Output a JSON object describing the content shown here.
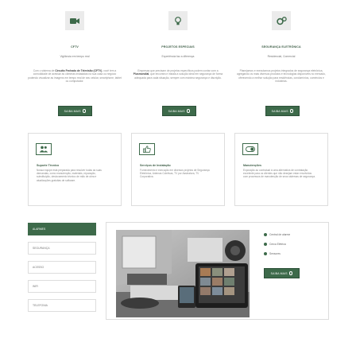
{
  "services": [
    {
      "icon": "video-camera-icon",
      "title": "CFTV",
      "subtitle": "Vigilância em tempo real",
      "description_pre": "Com o sistema de ",
      "description_bold": "Circuito Fechado de Televisão (CFTV)",
      "description_post": ", você tem a comodidade de acessar as câmeras instaladas na sua casa ou negócio podendo visualizar as imagens em tempo real de seu celular, smartphone, tablet ou computador.",
      "button": "Saiba mais"
    },
    {
      "icon": "lightbulb-icon",
      "title": "Projetos especiais",
      "subtitle": "Experiência faz a diferença",
      "description_pre": "Empresas que precisam de projetos específicos podem contar com a ",
      "description_bold": "Plusmondial",
      "description_post": ", que encontra e instala a solução ideal em segurança de forma adequada para cada situação, sempre com máxima segurança e discrição.",
      "button": "Saiba mais"
    },
    {
      "icon": "gears-icon",
      "title": "Segurança eletrônica",
      "subtitle": "Residencial, Comercial",
      "description_pre": "Planejamos e executamos projetos integrados de segurança eletrônica, agregando os mais diversos produtos e tecnologias disponíveis no mercado, oferecendo a melhor solução para residências, condomínios, comércios e indústrias.",
      "description_bold": "",
      "description_post": "",
      "button": "Saiba mais"
    }
  ],
  "cards": [
    {
      "icon": "users-icon",
      "title": "Suporte Técnico",
      "description": "Nossa equipe está preparada para resolver todas as suas demandas, como manutenção, materiais, reparação, substituição, deslocamento técnico de mão de obra e atualizações gratuitas de software."
    },
    {
      "icon": "thumbs-up-icon",
      "title": "Serviços de Instalação",
      "description": "Fornecimento e execução em diversos projetos de Segurança Eletrônica, Antenas Coletivas, TV por Assinatura, TV Corporativa."
    },
    {
      "icon": "toggle-icon",
      "title": "Manutenções",
      "description": "Exposição ao contratual à uma alternativa de contratação excelente para os clientes que não desejam estar envolvidos com processos de manutenção de seus sistemas de segurança."
    }
  ],
  "tabs": [
    "Alarmes",
    "Segurança",
    "Acesso",
    "WiFi",
    "Telefonia"
  ],
  "active_tab": "Alarmes",
  "features": [
    "Central de alarme",
    "Cerca Elétrica",
    "Sensores"
  ],
  "feature_button": "Saiba mais",
  "colors": {
    "accent": "#3d6a4a",
    "icon_bg": "#ebebeb"
  }
}
